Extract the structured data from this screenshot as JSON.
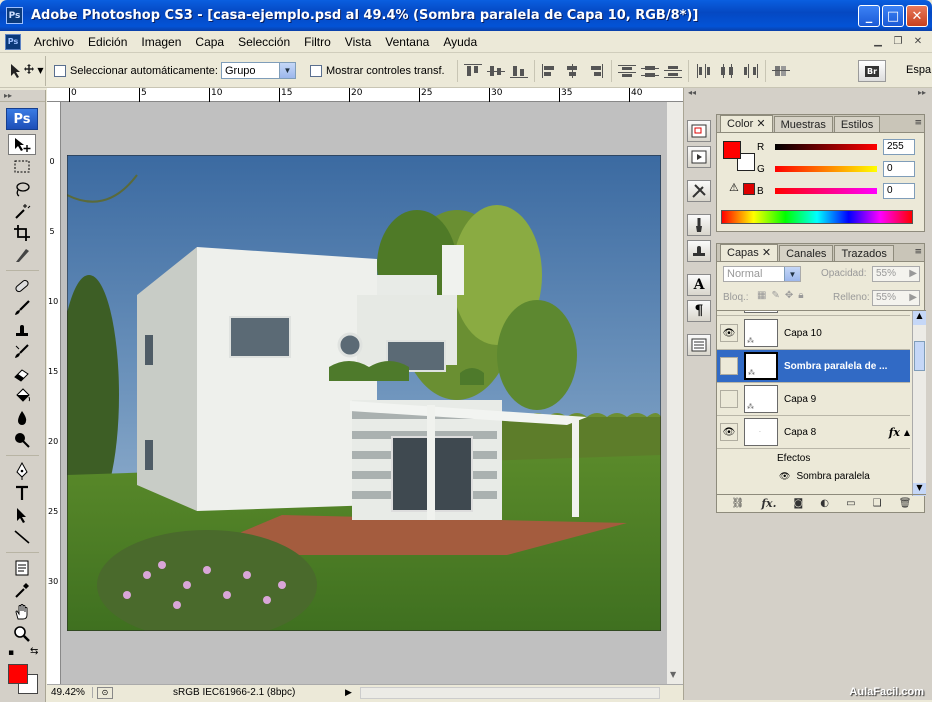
{
  "window": {
    "title": "Adobe Photoshop CS3 - [casa-ejemplo.psd al 49.4% (Sombra paralela de Capa 10, RGB/8*)]",
    "app_icon": "Ps",
    "buttons": {
      "minimize": "_",
      "maximize": "□",
      "close": "✕"
    }
  },
  "menu": [
    "Archivo",
    "Edición",
    "Imagen",
    "Capa",
    "Selección",
    "Filtro",
    "Vista",
    "Ventana",
    "Ayuda"
  ],
  "options": {
    "auto_select_label": "Seleccionar automáticamente:",
    "auto_select_value": "Grupo",
    "show_transform_label": "Mostrar controles transf.",
    "workspace_label": "Espa"
  },
  "toolbox": {
    "logo": "Ps",
    "tools": [
      "move-tool",
      "marquee-tool",
      "lasso-tool",
      "magic-wand-tool",
      "crop-tool",
      "slice-tool",
      "healing-brush-tool",
      "brush-tool",
      "clone-stamp-tool",
      "history-brush-tool",
      "eraser-tool",
      "gradient-tool",
      "blur-tool",
      "dodge-tool",
      "pen-tool",
      "type-tool",
      "path-selection-tool",
      "line-tool",
      "notes-tool",
      "eyedropper-tool",
      "hand-tool",
      "zoom-tool"
    ],
    "foreground_color": "#ff0000",
    "background_color": "#ffffff"
  },
  "rulers": {
    "top": [
      "0",
      "5",
      "10",
      "15",
      "20",
      "25",
      "30",
      "35",
      "40"
    ],
    "left": [
      "0",
      "5",
      "10",
      "15",
      "20",
      "25",
      "30"
    ]
  },
  "status": {
    "zoom": "49.42%",
    "profile": "sRGB IEC61966-2.1 (8bpc)"
  },
  "color_panel": {
    "tabs": [
      "Color",
      "Muestras",
      "Estilos"
    ],
    "r_label": "R",
    "g_label": "G",
    "b_label": "B",
    "r": "255",
    "g": "0",
    "b": "0",
    "fg_color": "#ff0000"
  },
  "layers_panel": {
    "tabs": [
      "Capas",
      "Canales",
      "Trazados"
    ],
    "blend_mode": "Normal",
    "opacity_label": "Opacidad:",
    "opacity": "55%",
    "lock_label": "Bloq.:",
    "fill_label": "Relleno:",
    "fill": "55%",
    "layers": [
      {
        "name": "Capa 10",
        "visible": true,
        "selected": false
      },
      {
        "name": "Sombra paralela de ...",
        "visible": false,
        "selected": true
      },
      {
        "name": "Capa 9",
        "visible": false,
        "selected": false
      },
      {
        "name": "Capa 8",
        "visible": true,
        "selected": false,
        "fx": "fx"
      }
    ],
    "effects_label": "Efectos",
    "effect_item": "Sombra paralela"
  },
  "watermark": "AulaFacil.com"
}
